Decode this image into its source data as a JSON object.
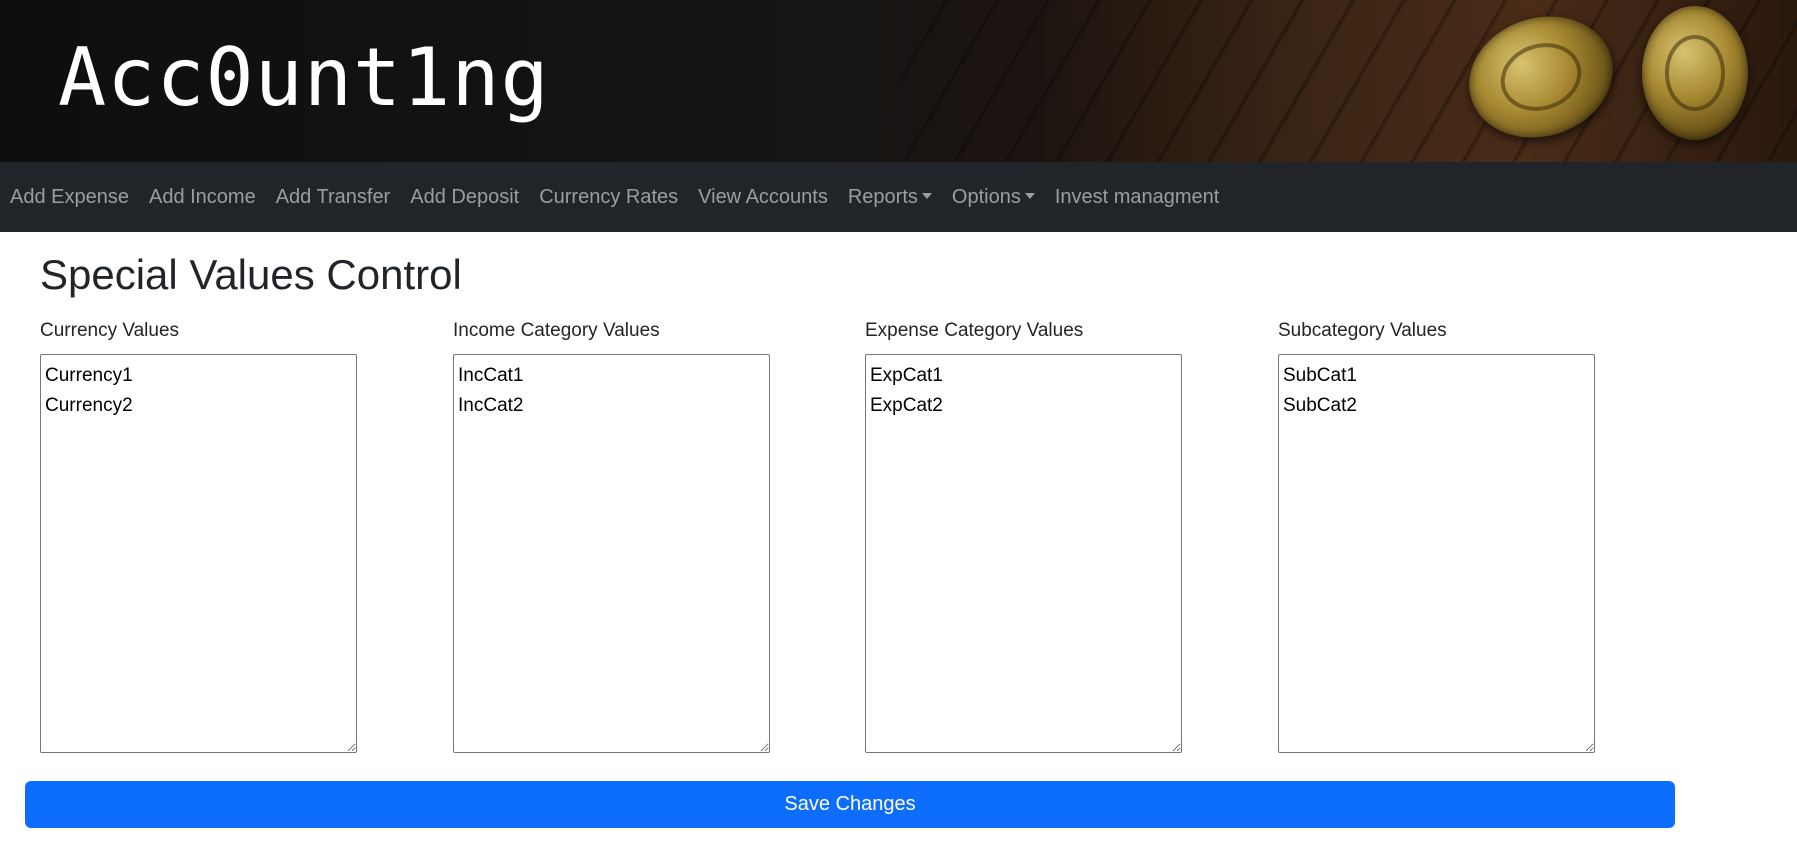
{
  "brand": {
    "title": "Acc0unt1ng"
  },
  "nav": {
    "items": [
      {
        "label": "Add Expense"
      },
      {
        "label": "Add Income"
      },
      {
        "label": "Add Transfer"
      },
      {
        "label": "Add Deposit"
      },
      {
        "label": "Currency Rates"
      },
      {
        "label": "View Accounts"
      },
      {
        "label": "Reports",
        "dropdown": true
      },
      {
        "label": "Options",
        "dropdown": true
      },
      {
        "label": "Invest managment"
      }
    ]
  },
  "page": {
    "title": "Special Values Control"
  },
  "fields": {
    "currency": {
      "label": "Currency Values",
      "value": "Currency1\nCurrency2"
    },
    "income": {
      "label": "Income Category Values",
      "value": "IncCat1\nIncCat2"
    },
    "expense": {
      "label": "Expense Category Values",
      "value": "ExpCat1\nExpCat2"
    },
    "subcategory": {
      "label": "Subcategory Values",
      "value": "SubCat1\nSubCat2"
    }
  },
  "actions": {
    "save_label": "Save Changes"
  },
  "colors": {
    "primary": "#0d6efd",
    "navbar": "#212529"
  }
}
